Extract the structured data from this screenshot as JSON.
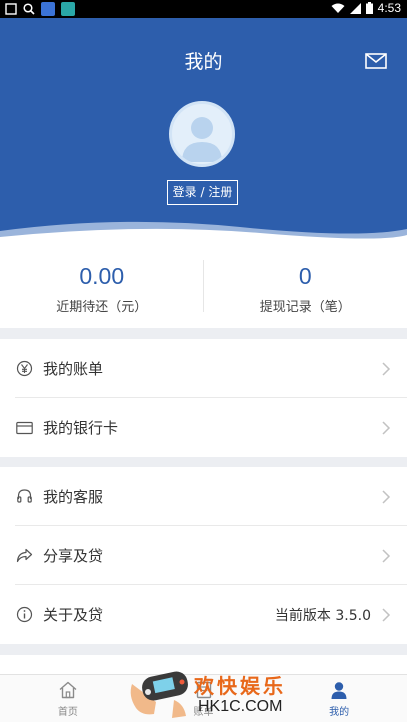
{
  "status_bar": {
    "time": "4:53",
    "icons": [
      "search-icon",
      "baidu-app-icon",
      "app-icon",
      "wifi-icon",
      "signal-icon",
      "battery-icon"
    ]
  },
  "header": {
    "title": "我的",
    "login_label": "登录 / 注册",
    "icons": [
      "mail-icon",
      "avatar-placeholder"
    ]
  },
  "stats": [
    {
      "value": "0.00",
      "label": "近期待还（元）"
    },
    {
      "value": "0",
      "label": "提现记录（笔）"
    }
  ],
  "menu": {
    "bill": {
      "label": "我的账单",
      "icon": "yen-circle-icon"
    },
    "bank_card": {
      "label": "我的银行卡",
      "icon": "bank-card-icon"
    },
    "service": {
      "label": "我的客服",
      "icon": "headset-icon"
    },
    "share": {
      "label": "分享及贷",
      "icon": "share-icon"
    },
    "about": {
      "label": "关于及贷",
      "value": "当前版本 3.5.0",
      "icon": "info-icon"
    }
  },
  "tabbar": [
    {
      "label": "首页",
      "icon": "home-icon",
      "active": false
    },
    {
      "label": "账单",
      "icon": "bill-icon",
      "active": false
    },
    {
      "label": "我的",
      "icon": "user-icon",
      "active": true
    }
  ],
  "watermark": {
    "title": "欢快娱乐",
    "url": "HK1C.COM"
  },
  "colors": {
    "brand": "#2d5eac",
    "section_gap": "#eceef2",
    "watermark_orange": "#e8681a"
  }
}
